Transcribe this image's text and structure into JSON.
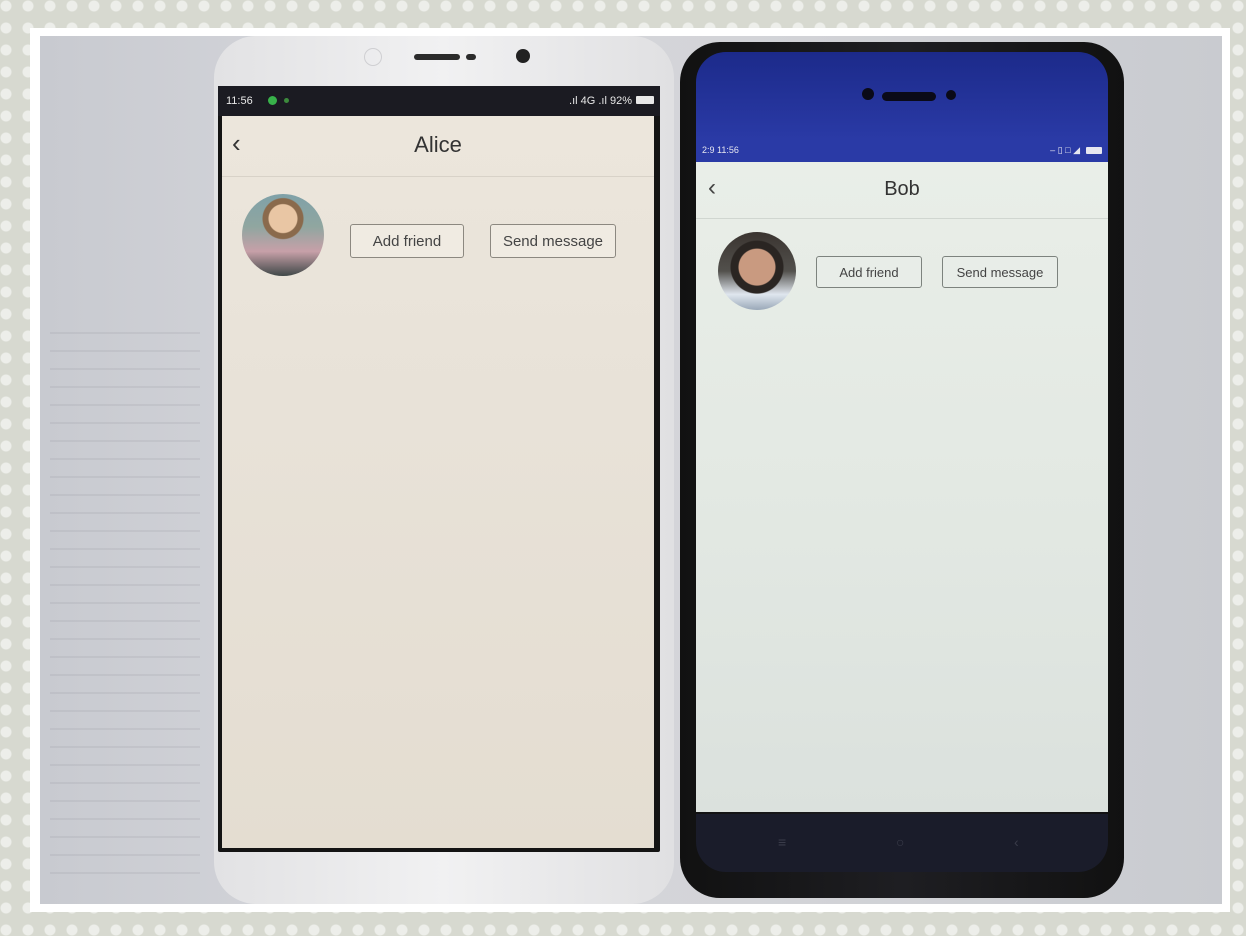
{
  "left_phone": {
    "status": {
      "time": "11:56",
      "signal_text": ".ıl 4G .ıl 92%"
    },
    "header": {
      "back_icon": "chevron-left-icon",
      "title": "Alice"
    },
    "profile": {
      "avatar_icon": "user-photo",
      "add_friend_label": "Add friend",
      "send_message_label": "Send message"
    }
  },
  "right_phone": {
    "status": {
      "time": "2:9 11:56"
    },
    "header": {
      "back_icon": "chevron-left-icon",
      "title": "Bob"
    },
    "profile": {
      "avatar_icon": "user-photo",
      "add_friend_label": "Add friend",
      "send_message_label": "Send message"
    }
  },
  "colors": {
    "status_green": "#38b24a",
    "right_phone_blue": "#2a3aa6"
  }
}
